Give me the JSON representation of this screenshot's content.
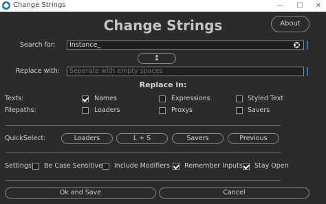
{
  "window": {
    "title": "Change Strings"
  },
  "header": {
    "title": "Change Strings",
    "about_label": "About"
  },
  "search": {
    "label": "Search for:",
    "value": "Instance_"
  },
  "swap": {
    "label": "↕"
  },
  "replace": {
    "label": "Replace with:",
    "placeholder": "Seperate with empty spaces"
  },
  "replace_in": {
    "title": "Replace in:",
    "texts_label": "Texts:",
    "filepaths_label": "Filepaths:",
    "options": {
      "names": {
        "label": "Names",
        "checked": true
      },
      "expressions": {
        "label": "Expressions",
        "checked": false
      },
      "styled_text": {
        "label": "Styled Text",
        "checked": false
      },
      "loaders": {
        "label": "Loaders",
        "checked": false
      },
      "proxys": {
        "label": "Proxys",
        "checked": false
      },
      "savers": {
        "label": "Savers",
        "checked": false
      }
    }
  },
  "quickselect": {
    "label": "QuickSelect:",
    "buttons": [
      "Loaders",
      "L + S",
      "Savers",
      "Previous"
    ]
  },
  "settings": {
    "label": "Settings:",
    "be_case_sensitive": {
      "label": "Be Case Sensitive",
      "checked": false
    },
    "include_modifiers": {
      "label": "Include Modifiers",
      "checked": false
    },
    "remember_inputs": {
      "label": "Remember Inputs",
      "checked": true
    },
    "stay_open": {
      "label": "Stay Open",
      "checked": true
    }
  },
  "actions": {
    "ok_label": "Ok and Save",
    "cancel_label": "Cancel"
  }
}
